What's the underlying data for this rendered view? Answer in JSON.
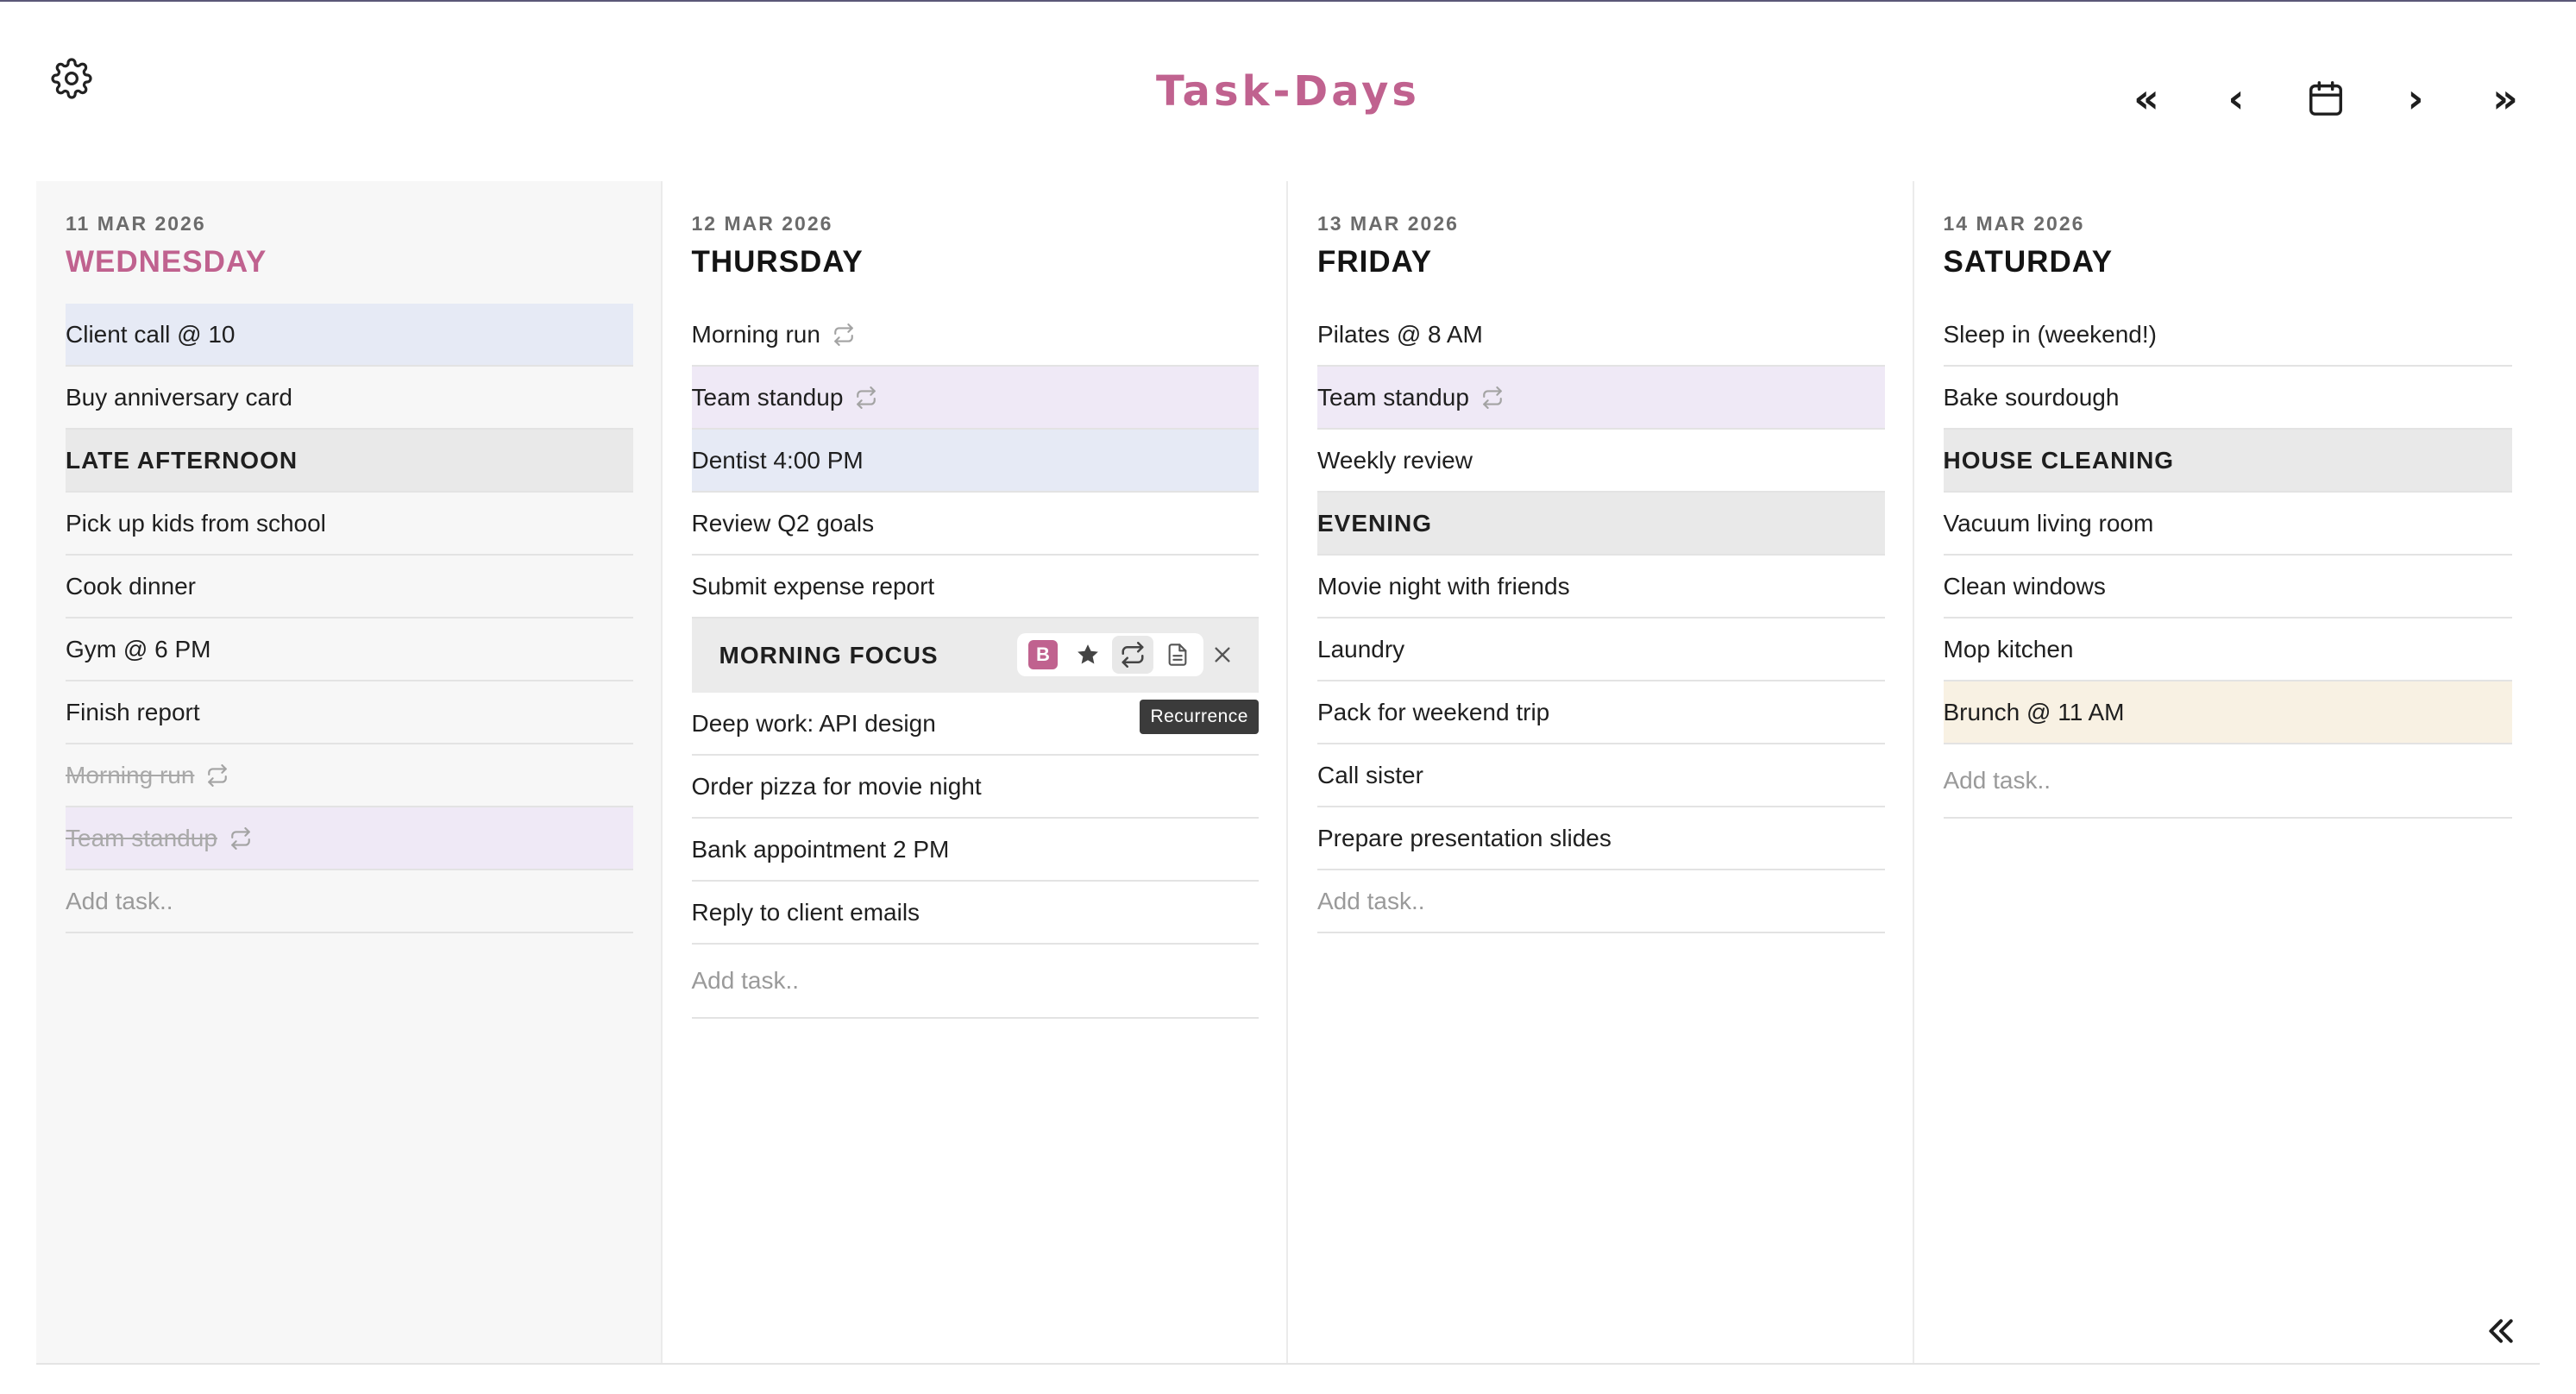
{
  "app": {
    "title": "Task-Days"
  },
  "icons": {
    "settings": "gear-icon",
    "first": "double-chevron-left-icon",
    "prev": "chevron-left-icon",
    "today": "calendar-icon",
    "next": "chevron-right-icon",
    "last": "double-chevron-right-icon",
    "collapse": "double-chevron-left-icon",
    "recurrence": "repeat-icon"
  },
  "colors": {
    "accent": "#c0628f",
    "blue_highlight": "#e6eaf5",
    "purple_highlight": "#efe9f6",
    "cream_highlight": "#f8f1e3",
    "section": "#e9e9e9"
  },
  "nav": {
    "first": "«",
    "prev": "‹",
    "next": "›",
    "last": "»"
  },
  "days": [
    {
      "date": "11 MAR 2026",
      "name": "WEDNESDAY",
      "today": true,
      "tasks": [
        {
          "label": "Client call @ 10",
          "color": "blue"
        },
        {
          "label": "Buy anniversary card"
        },
        {
          "label": "LATE AFTERNOON",
          "section": true
        },
        {
          "label": "Pick up kids from school"
        },
        {
          "label": "Cook dinner"
        },
        {
          "label": "Gym @ 6 PM"
        },
        {
          "label": "Finish report"
        },
        {
          "label": "Morning run",
          "done": true,
          "recurring": true
        },
        {
          "label": "Team standup",
          "done": true,
          "recurring": true,
          "color": "purple"
        }
      ],
      "add_placeholder": "Add task.."
    },
    {
      "date": "12 MAR 2026",
      "name": "THURSDAY",
      "tasks": [
        {
          "label": "Morning run",
          "recurring": true
        },
        {
          "label": "Team standup",
          "recurring": true,
          "color": "purple"
        },
        {
          "label": "Dentist 4:00 PM",
          "color": "blue"
        },
        {
          "label": "Review Q2 goals"
        },
        {
          "label": "Submit expense report"
        },
        {
          "label": "MORNING FOCUS",
          "section": true,
          "editing": true
        },
        {
          "label": "Deep work: API design"
        },
        {
          "label": "Order pizza for movie night"
        },
        {
          "label": "Bank appointment 2 PM"
        },
        {
          "label": "Reply to client emails"
        }
      ],
      "add_placeholder": "Add task.."
    },
    {
      "date": "13 MAR 2026",
      "name": "FRIDAY",
      "tasks": [
        {
          "label": "Pilates @ 8 AM"
        },
        {
          "label": "Team standup",
          "recurring": true,
          "color": "purple"
        },
        {
          "label": "Weekly review"
        },
        {
          "label": "EVENING",
          "section": true
        },
        {
          "label": "Movie night with friends"
        },
        {
          "label": "Laundry"
        },
        {
          "label": "Pack for weekend trip"
        },
        {
          "label": "Call sister"
        },
        {
          "label": "Prepare presentation slides"
        }
      ],
      "add_placeholder": "Add task.."
    },
    {
      "date": "14 MAR 2026",
      "name": "SATURDAY",
      "tasks": [
        {
          "label": "Sleep in (weekend!)"
        },
        {
          "label": "Bake sourdough"
        },
        {
          "label": "HOUSE CLEANING",
          "section": true
        },
        {
          "label": "Vacuum living room"
        },
        {
          "label": "Clean windows"
        },
        {
          "label": "Mop kitchen"
        },
        {
          "label": "Brunch @ 11 AM",
          "color": "cream"
        }
      ],
      "add_placeholder": "Add task.."
    }
  ],
  "editor_toolbar": {
    "bold_label": "B",
    "bold_icon": "bold-icon",
    "star_icon": "star-icon",
    "recurrence_icon": "repeat-icon",
    "note_icon": "note-icon",
    "close_icon": "close-icon",
    "tooltip": "Recurrence"
  }
}
